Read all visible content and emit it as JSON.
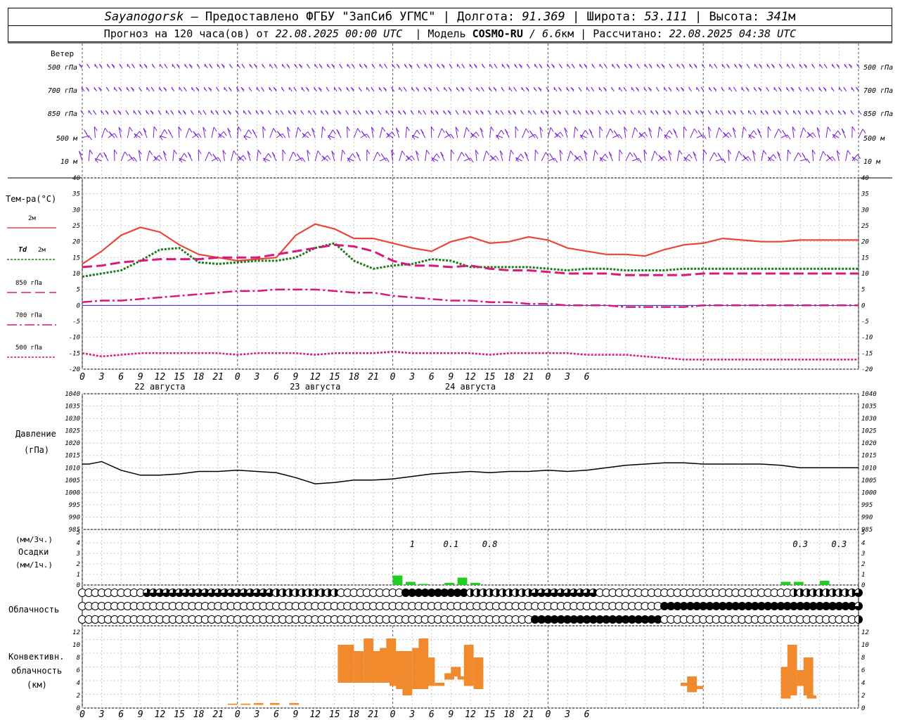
{
  "header": {
    "station": "Sayanogorsk",
    "provider": "— Предоставлено ФГБУ \"ЗапСиб УГМС\"",
    "lon_label": "Долгота:",
    "lon_value": "91.369",
    "lat_label": "Широта:",
    "lat_value": "53.111",
    "alt_label": "Высота:",
    "alt_value": "341",
    "alt_unit": "м",
    "forecast_label": "Прогноз на 120 часа(ов) от",
    "forecast_from": "22.08.2025 00:00 UTC",
    "model_label": "Модель",
    "model_name": "COSMO-RU",
    "model_res": "/ 6.6",
    "model_res_unit": "км",
    "calc_label": "Рассчитано:",
    "calc_time": "22.08.2025 04:38 UTC"
  },
  "time_axis": {
    "hour_labels": [
      "0",
      "3",
      "6",
      "9",
      "12",
      "15",
      "18",
      "21",
      "0",
      "3",
      "6",
      "9",
      "12",
      "15",
      "18",
      "21",
      "0",
      "3",
      "6",
      "9",
      "12",
      "15",
      "18",
      "21",
      "0",
      "3",
      "6"
    ],
    "day_labels": [
      "22 августа",
      "23 августа",
      "24 августа"
    ]
  },
  "wind_panel": {
    "title": "Ветер",
    "levels": [
      "500 гПа",
      "700 гПа",
      "850 гПа",
      "500 м",
      "10 м"
    ],
    "color": "#7a1fd6"
  },
  "temperature_panel": {
    "title": "Тем-ра(°С)",
    "legend": [
      {
        "label": "2м",
        "color": "#e8463b",
        "style": "solid"
      },
      {
        "label": "Td 2м",
        "color": "#1f7a1f",
        "style": "dotted"
      },
      {
        "label": "850 гПа",
        "color": "#d8197a",
        "style": "dashed"
      },
      {
        "label": "700 гПа",
        "color": "#d8197a",
        "style": "dashdot"
      },
      {
        "label": "500 гПа",
        "color": "#d8197a",
        "style": "dotted"
      }
    ],
    "y_ticks": [
      "40",
      "35",
      "30",
      "25",
      "20",
      "15",
      "10",
      "5",
      "0",
      "-5",
      "-10",
      "-15",
      "-20"
    ],
    "zero_line_color": "#2222dd"
  },
  "pressure_panel": {
    "title_line1": "Давление",
    "title_line2": "(гПа)",
    "y_ticks": [
      "1040",
      "1035",
      "1030",
      "1025",
      "1020",
      "1015",
      "1010",
      "1005",
      "1000",
      "995",
      "990",
      "985"
    ]
  },
  "precip_panel": {
    "unit_3h": "(мм/3ч.)",
    "title": "Осадки",
    "unit_1h": "(мм/1ч.)",
    "y_ticks": [
      "5",
      "4",
      "3",
      "2",
      "1",
      "0"
    ],
    "amount_labels": [
      {
        "hour": 51,
        "text": "1"
      },
      {
        "hour": 57,
        "text": "0.1"
      },
      {
        "hour": 63,
        "text": "0.8"
      },
      {
        "hour": 111,
        "text": "0.3"
      },
      {
        "hour": 117,
        "text": "0.3"
      }
    ],
    "bar_color": "#22cc22"
  },
  "cloud_panel": {
    "title": "Облачность"
  },
  "convective_panel": {
    "title_line1": "Конвективн.",
    "title_line2": "облачность",
    "title_line3": "(км)",
    "y_ticks": [
      "12",
      "10",
      "8",
      "6",
      "4",
      "2",
      "0"
    ],
    "bar_color": "#f08a2c"
  },
  "chart_data": [
    {
      "type": "line",
      "title": "Тем-ра(°С)",
      "x_unit": "hours since 22.08.2025 00:00 UTC",
      "ylim": [
        -20,
        40
      ],
      "series": [
        {
          "name": "2м",
          "x": [
            0,
            3,
            6,
            9,
            12,
            15,
            18,
            21,
            24,
            27,
            30,
            33,
            36,
            39,
            42,
            45,
            48,
            51,
            54,
            57,
            60,
            63,
            66,
            69,
            72,
            75,
            78,
            81,
            84,
            87,
            90,
            93,
            96,
            99,
            102,
            105,
            108,
            111,
            114,
            117,
            120
          ],
          "values": [
            13,
            17,
            22,
            24.5,
            23,
            19,
            16,
            15,
            14,
            14.5,
            15,
            22,
            25.5,
            24,
            21,
            21,
            19.5,
            18,
            17,
            20,
            21.5,
            19.5,
            20,
            21.5,
            20.5,
            18,
            17,
            16,
            16,
            15.5,
            17.5,
            19,
            19.5,
            21,
            20.5,
            20,
            20,
            20.5,
            20.5,
            20.5,
            20.5
          ]
        },
        {
          "name": "Td 2м",
          "x": [
            0,
            3,
            6,
            9,
            12,
            15,
            18,
            21,
            24,
            27,
            30,
            33,
            36,
            39,
            42,
            45,
            48,
            51,
            54,
            57,
            60,
            63,
            66,
            69,
            72,
            75,
            78,
            81,
            84,
            87,
            90,
            93,
            96,
            99,
            102,
            105,
            108,
            111,
            114,
            117,
            120
          ],
          "values": [
            9,
            10,
            11,
            14,
            17.5,
            18,
            13.5,
            13,
            13.5,
            14,
            14,
            15,
            18,
            19.5,
            14,
            11.5,
            12.5,
            13,
            14.5,
            14,
            12,
            12,
            12,
            12,
            11.5,
            11,
            11.5,
            11.5,
            11,
            11,
            11,
            11.5,
            11.5,
            11.5,
            11.5,
            11.5,
            11.5,
            11.5,
            11.5,
            11.5,
            11.5
          ]
        },
        {
          "name": "850 гПа",
          "x": [
            0,
            3,
            6,
            9,
            12,
            15,
            18,
            21,
            24,
            27,
            30,
            33,
            36,
            39,
            42,
            45,
            48,
            51,
            54,
            57,
            60,
            63,
            66,
            69,
            72,
            75,
            78,
            81,
            84,
            87,
            90,
            93,
            96,
            99,
            102,
            105,
            108,
            111,
            114,
            117,
            120
          ],
          "values": [
            12,
            12.5,
            13.5,
            14,
            14.5,
            14.5,
            14.5,
            15,
            15,
            15,
            16,
            17,
            18,
            19,
            18.5,
            17,
            14,
            12.5,
            12.5,
            12,
            12.5,
            11.5,
            11,
            11,
            10.5,
            10,
            10,
            10,
            9.5,
            9.5,
            9.5,
            9.5,
            10,
            10,
            10,
            10,
            10,
            10,
            10,
            10,
            10
          ]
        },
        {
          "name": "700 гПа",
          "x": [
            0,
            3,
            6,
            9,
            12,
            15,
            18,
            21,
            24,
            27,
            30,
            33,
            36,
            39,
            42,
            45,
            48,
            51,
            54,
            57,
            60,
            63,
            66,
            69,
            72,
            75,
            78,
            81,
            84,
            87,
            90,
            93,
            96,
            99,
            102,
            105,
            108,
            111,
            114,
            117,
            120
          ],
          "values": [
            1,
            1.5,
            1.5,
            2,
            2.5,
            3,
            3.5,
            4,
            4.5,
            4.5,
            5,
            5,
            5,
            4.5,
            4,
            4,
            3,
            2.5,
            2,
            1.5,
            1.5,
            1,
            1,
            0.5,
            0.5,
            0,
            0,
            0,
            -0.5,
            -0.5,
            -0.5,
            -0.5,
            0,
            0,
            0,
            0,
            0,
            0,
            0,
            0,
            0
          ]
        },
        {
          "name": "500 гПа",
          "x": [
            0,
            3,
            6,
            9,
            12,
            15,
            18,
            21,
            24,
            27,
            30,
            33,
            36,
            39,
            42,
            45,
            48,
            51,
            54,
            57,
            60,
            63,
            66,
            69,
            72,
            75,
            78,
            81,
            84,
            87,
            90,
            93,
            96,
            99,
            102,
            105,
            108,
            111,
            114,
            117,
            120
          ],
          "values": [
            -15,
            -16,
            -15.5,
            -15,
            -15,
            -15,
            -15,
            -15,
            -15.5,
            -15,
            -15,
            -15,
            -15.5,
            -15,
            -15,
            -15,
            -14.5,
            -15,
            -15,
            -15,
            -15,
            -15.5,
            -15,
            -15,
            -15,
            -15,
            -15.5,
            -15.5,
            -15.5,
            -16,
            -16.5,
            -17,
            -17,
            -17,
            -17,
            -17,
            -17,
            -17,
            -17,
            -17,
            -17
          ]
        }
      ]
    },
    {
      "type": "line",
      "title": "Давление",
      "x_unit": "hours since 22.08.2025 00:00 UTC",
      "ylim": [
        985,
        1040
      ],
      "series": [
        {
          "x": [
            0,
            1,
            2,
            3,
            6,
            9,
            12,
            15,
            18,
            21,
            24,
            27,
            30,
            33,
            36,
            39,
            42,
            45,
            48,
            51,
            54,
            57,
            60,
            63,
            66,
            69,
            72,
            75,
            78,
            81,
            84,
            87,
            90,
            93,
            96,
            99,
            102,
            105,
            108,
            111,
            114,
            117,
            120
          ],
          "values": [
            1011.5,
            1011.5,
            1012,
            1012.5,
            1009,
            1007,
            1007,
            1007.5,
            1008.5,
            1008.5,
            1009,
            1008.5,
            1008,
            1006,
            1003.5,
            1004,
            1005,
            1005,
            1005.5,
            1006.5,
            1007.5,
            1008,
            1008.5,
            1008,
            1008.5,
            1008.5,
            1009,
            1008.5,
            1009,
            1010,
            1011,
            1011.5,
            1012,
            1012,
            1011.5,
            1011.5,
            1011.5,
            1011.5,
            1011,
            1010,
            1010,
            1010,
            1010
          ]
        }
      ]
    },
    {
      "type": "bar",
      "title": "Осадки",
      "x_unit": "hours since 22.08.2025 00:00 UTC",
      "ylim": [
        0,
        5
      ],
      "x": [
        48,
        50,
        52,
        54,
        56,
        58,
        60,
        62,
        104,
        106,
        108,
        110,
        112,
        114,
        116,
        118
      ],
      "values": [
        0.9,
        0.3,
        0.1,
        0.0,
        0.2,
        0.7,
        0.2,
        0.0,
        0.0,
        0.0,
        0.3,
        0.3,
        0.0,
        0.4,
        0.0,
        0.0
      ]
    },
    {
      "type": "bar",
      "title": "Конвективн. облачность",
      "x_unit": "hours since 22.08.2025 00:00 UTC",
      "ylim": [
        0,
        13
      ],
      "bars": [
        {
          "x": 22.5,
          "bottom": 0.5,
          "top": 0.7
        },
        {
          "x": 24.5,
          "bottom": 0.5,
          "top": 0.7
        },
        {
          "x": 26.5,
          "bottom": 0.5,
          "top": 0.8
        },
        {
          "x": 29,
          "bottom": 0.5,
          "top": 0.8
        },
        {
          "x": 32,
          "bottom": 0.5,
          "top": 0.8
        },
        {
          "x": 39.5,
          "bottom": 4,
          "top": 10
        },
        {
          "x": 40.5,
          "bottom": 4,
          "top": 10
        },
        {
          "x": 42,
          "bottom": 4,
          "top": 9
        },
        {
          "x": 43.5,
          "bottom": 4,
          "top": 11
        },
        {
          "x": 45,
          "bottom": 4,
          "top": 9
        },
        {
          "x": 46,
          "bottom": 4,
          "top": 9.5
        },
        {
          "x": 47,
          "bottom": 4,
          "top": 11
        },
        {
          "x": 47.5,
          "bottom": 3.5,
          "top": 9
        },
        {
          "x": 48.5,
          "bottom": 3,
          "top": 9
        },
        {
          "x": 49.5,
          "bottom": 2,
          "top": 9
        },
        {
          "x": 51,
          "bottom": 3,
          "top": 9.5
        },
        {
          "x": 52,
          "bottom": 3,
          "top": 11
        },
        {
          "x": 53,
          "bottom": 3.5,
          "top": 8
        },
        {
          "x": 54.5,
          "bottom": 3.5,
          "top": 4
        },
        {
          "x": 56,
          "bottom": 4.5,
          "top": 5.5
        },
        {
          "x": 57,
          "bottom": 5,
          "top": 6.5
        },
        {
          "x": 58,
          "bottom": 4.5,
          "top": 5
        },
        {
          "x": 59,
          "bottom": 3.5,
          "top": 10
        },
        {
          "x": 60.5,
          "bottom": 3,
          "top": 8
        },
        {
          "x": 92.5,
          "bottom": 3.5,
          "top": 4
        },
        {
          "x": 93.5,
          "bottom": 2.5,
          "top": 5
        },
        {
          "x": 94.5,
          "bottom": 3,
          "top": 3.5
        },
        {
          "x": 108,
          "bottom": 1.5,
          "top": 6.5
        },
        {
          "x": 109,
          "bottom": 2,
          "top": 10
        },
        {
          "x": 110.5,
          "bottom": 3.5,
          "top": 6
        },
        {
          "x": 111.5,
          "bottom": 2,
          "top": 8
        },
        {
          "x": 112,
          "bottom": 1.5,
          "top": 2
        }
      ]
    }
  ]
}
